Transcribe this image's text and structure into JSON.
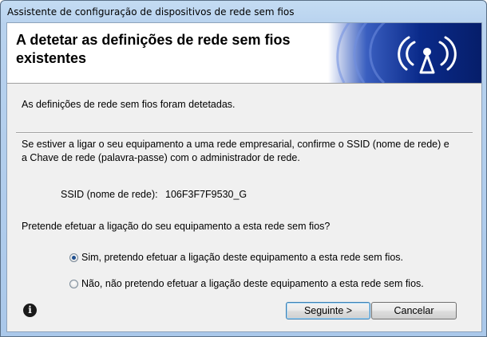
{
  "window": {
    "title": "Assistente de configuração de dispositivos de rede sem fios"
  },
  "header": {
    "title": "A detetar as definições de rede sem fios existentes"
  },
  "body": {
    "detected_text": "As definições de rede sem fios foram detetadas.",
    "enterprise_line1": "Se estiver a ligar o seu equipamento a uma rede empresarial, confirme o SSID (nome de rede) e",
    "enterprise_line2": "a Chave de rede (palavra-passe) com o administrador de rede.",
    "ssid_label": "SSID (nome de rede):",
    "ssid_value": "106F3F7F9530_G",
    "question": "Pretende efetuar a ligação do seu equipamento a esta rede sem fios?"
  },
  "options": [
    {
      "label": "Sim, pretendo efetuar a ligação deste equipamento a esta rede sem fios.",
      "selected": true
    },
    {
      "label": "Não, não pretendo efetuar a ligação deste equipamento a esta rede sem fios.",
      "selected": false
    }
  ],
  "buttons": {
    "next": "Seguinte >",
    "cancel": "Cancelar"
  },
  "icons": {
    "info": "info-icon",
    "banner": "wireless-signal-icon"
  },
  "colors": {
    "banner_blue": "#0a2a8a",
    "title_bar": "#b9d3ef"
  }
}
